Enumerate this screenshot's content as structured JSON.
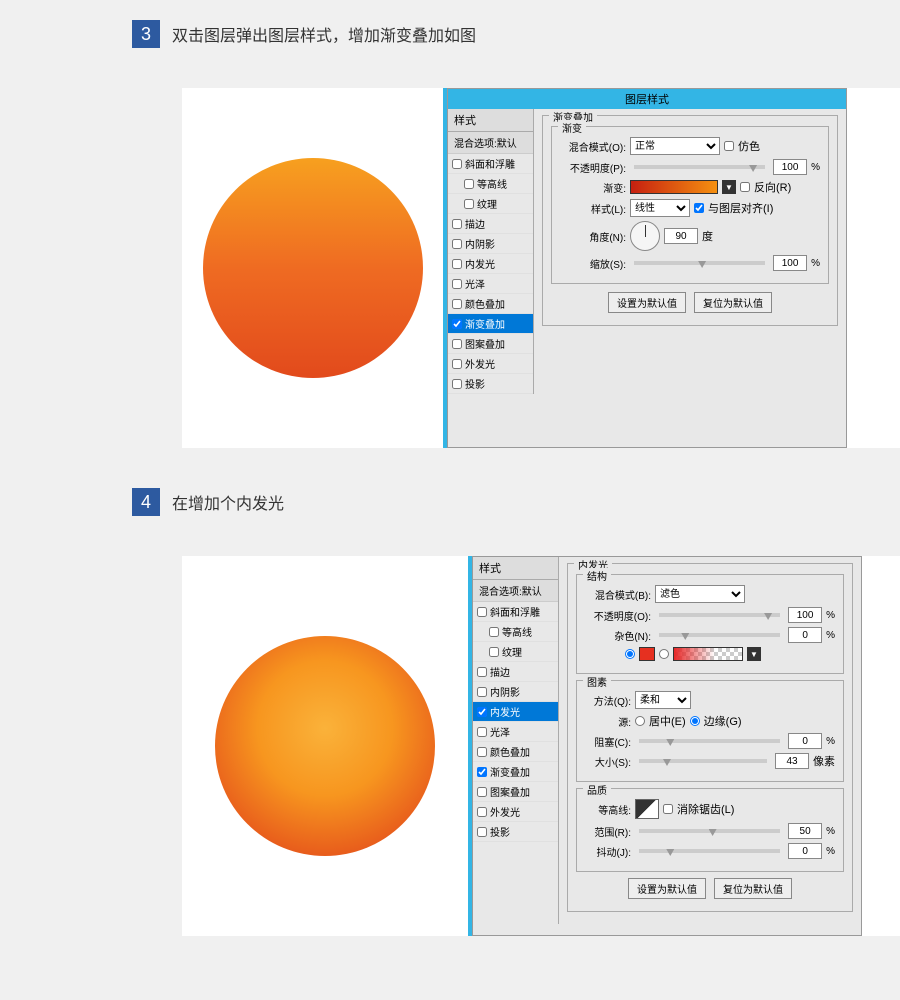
{
  "steps": {
    "s3": {
      "num": "3",
      "title": "双击图层弹出图层样式，增加渐变叠加如图"
    },
    "s4": {
      "num": "4",
      "title": "在增加个内发光"
    }
  },
  "dialog1": {
    "title": "图层样式",
    "styles_header": "样式",
    "blend_options": "混合选项:默认",
    "items": {
      "bevel": "斜面和浮雕",
      "contour": "等高线",
      "texture": "纹理",
      "stroke": "描边",
      "inner_shadow": "内阴影",
      "inner_glow": "内发光",
      "satin": "光泽",
      "color_overlay": "颜色叠加",
      "gradient_overlay": "渐变叠加",
      "pattern_overlay": "图案叠加",
      "outer_glow": "外发光",
      "drop_shadow": "投影"
    },
    "panel": {
      "section": "渐变叠加",
      "sub": "渐变",
      "blend_mode_lbl": "混合模式(O):",
      "blend_mode_val": "正常",
      "dither": "仿色",
      "opacity_lbl": "不透明度(P):",
      "opacity_val": "100",
      "gradient_lbl": "渐变:",
      "reverse": "反向(R)",
      "style_lbl": "样式(L):",
      "style_val": "线性",
      "align": "与图层对齐(I)",
      "angle_lbl": "角度(N):",
      "angle_val": "90",
      "angle_unit": "度",
      "scale_lbl": "缩放(S):",
      "scale_val": "100",
      "btn_default": "设置为默认值",
      "btn_reset": "复位为默认值"
    }
  },
  "dialog2": {
    "styles_header": "样式",
    "blend_options": "混合选项:默认",
    "items": {
      "bevel": "斜面和浮雕",
      "contour": "等高线",
      "texture": "纹理",
      "stroke": "描边",
      "inner_shadow": "内阴影",
      "inner_glow": "内发光",
      "satin": "光泽",
      "color_overlay": "颜色叠加",
      "gradient_overlay": "渐变叠加",
      "pattern_overlay": "图案叠加",
      "outer_glow": "外发光",
      "drop_shadow": "投影"
    },
    "panel": {
      "section": "内发光",
      "struct": "结构",
      "blend_mode_lbl": "混合模式(B):",
      "blend_mode_val": "滤色",
      "opacity_lbl": "不透明度(O):",
      "opacity_val": "100",
      "noise_lbl": "杂色(N):",
      "noise_val": "0",
      "elements": "图素",
      "method_lbl": "方法(Q):",
      "method_val": "柔和",
      "source_lbl": "源:",
      "source_center": "居中(E)",
      "source_edge": "边缘(G)",
      "choke_lbl": "阻塞(C):",
      "choke_val": "0",
      "size_lbl": "大小(S):",
      "size_val": "43",
      "size_unit": "像素",
      "quality": "品质",
      "contour_lbl": "等高线:",
      "antialias": "消除锯齿(L)",
      "range_lbl": "范围(R):",
      "range_val": "50",
      "jitter_lbl": "抖动(J):",
      "jitter_val": "0",
      "btn_default": "设置为默认值",
      "btn_reset": "复位为默认值"
    }
  },
  "pct": "%"
}
